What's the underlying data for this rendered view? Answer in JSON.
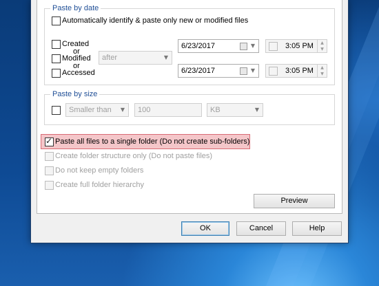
{
  "paste_by_date": {
    "title": "Paste by date",
    "auto_identify_label": "Automatically identify & paste only new or modified files",
    "created_label": "Created",
    "or1": "or",
    "modified_label": "Modified",
    "or2": "or",
    "accessed_label": "Accessed",
    "condition_value": "after",
    "date1": "6/23/2017",
    "time1": "3:05 PM",
    "date2": "6/23/2017",
    "time2": "3:05 PM"
  },
  "paste_by_size": {
    "title": "Paste by size",
    "comparison_value": "Smaller than",
    "size_value": "100",
    "unit_value": "KB"
  },
  "options": {
    "single_folder_label": "Paste all files to a single folder (Do not create sub-folders)",
    "single_folder_checked": true,
    "structure_only_label": "Create folder structure only (Do not paste files)",
    "no_empty_folders_label": "Do not keep empty folders",
    "full_hierarchy_label": "Create full folder hierarchy"
  },
  "buttons": {
    "preview": "Preview",
    "ok": "OK",
    "cancel": "Cancel",
    "help": "Help"
  }
}
